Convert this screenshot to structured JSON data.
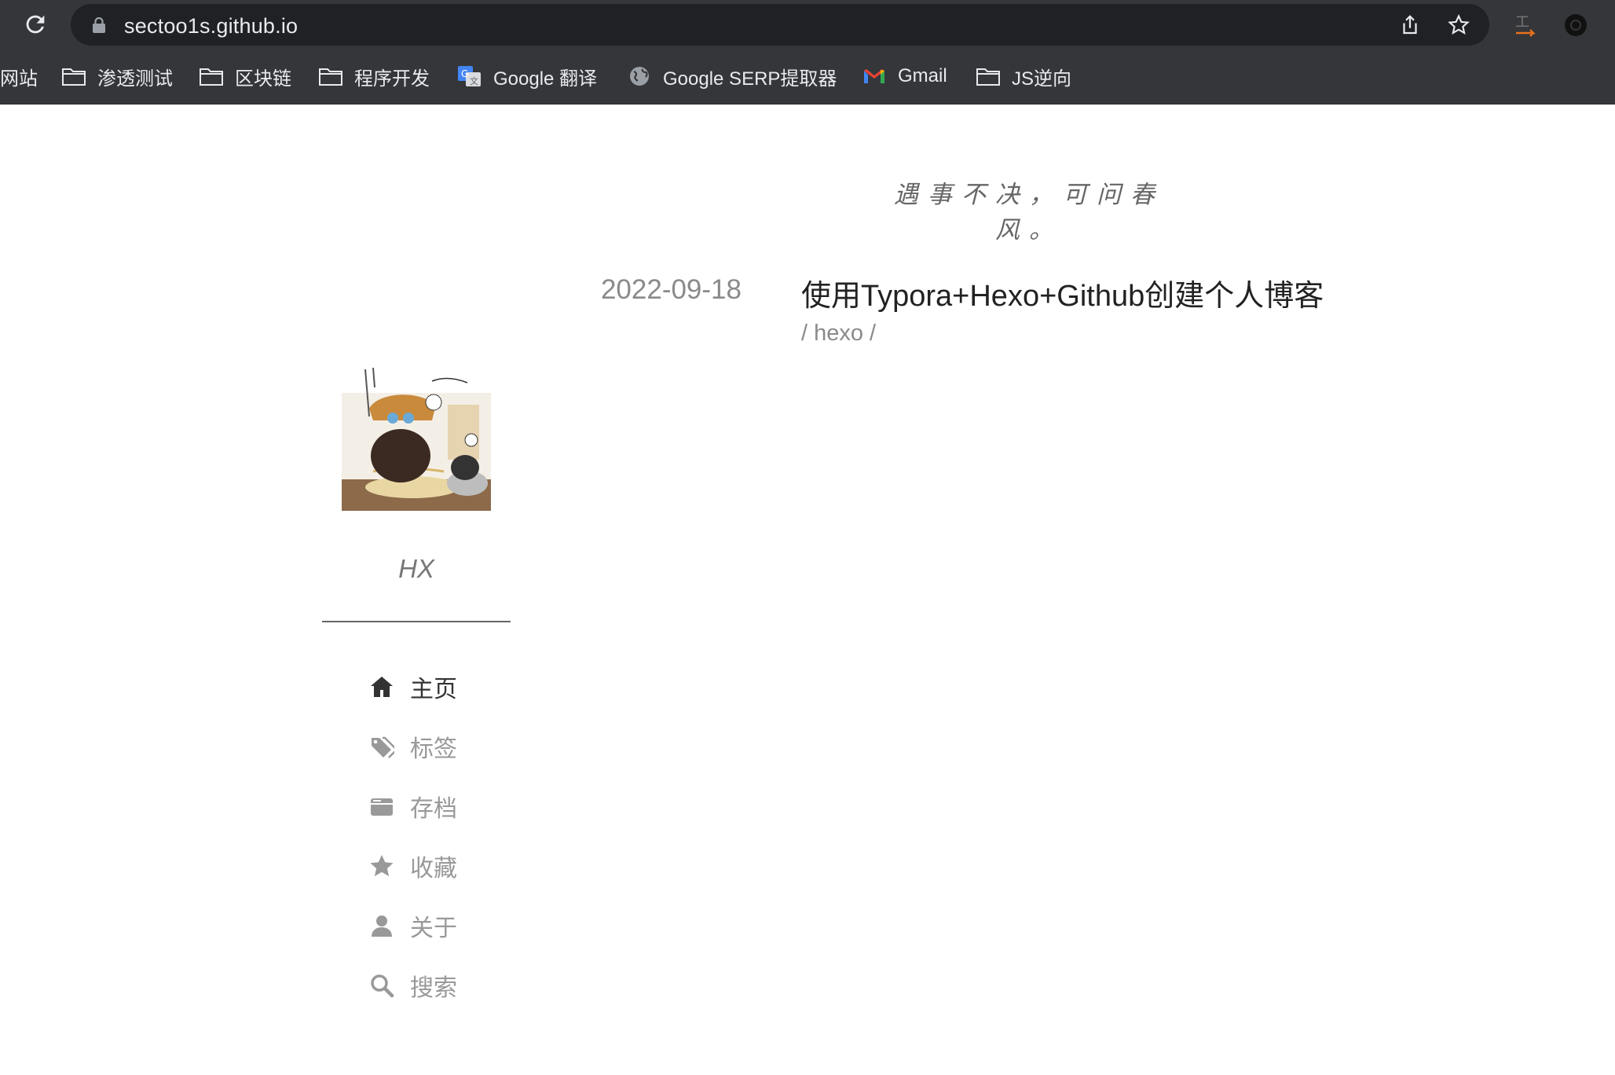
{
  "browser": {
    "url": "sectoo1s.github.io",
    "bookmarks": [
      {
        "label": "网站",
        "icon": "folder-icon"
      },
      {
        "label": "渗透测试",
        "icon": "folder-icon"
      },
      {
        "label": "区块链",
        "icon": "folder-icon"
      },
      {
        "label": "程序开发",
        "icon": "folder-icon"
      },
      {
        "label": "Google 翻译",
        "icon": "google-translate-icon"
      },
      {
        "label": "Google SERP提取器",
        "icon": "globe-icon"
      },
      {
        "label": "Gmail",
        "icon": "gmail-icon"
      },
      {
        "label": "JS逆向",
        "icon": "folder-icon"
      }
    ]
  },
  "blog": {
    "motto": "遇事不决，可问春风。",
    "author": "HX",
    "menu": [
      {
        "label": "主页",
        "icon": "home-icon",
        "active": true
      },
      {
        "label": "标签",
        "icon": "tags-icon",
        "active": false
      },
      {
        "label": "存档",
        "icon": "archive-icon",
        "active": false
      },
      {
        "label": "收藏",
        "icon": "star-icon",
        "active": false
      },
      {
        "label": "关于",
        "icon": "user-icon",
        "active": false
      },
      {
        "label": "搜索",
        "icon": "search-icon",
        "active": false
      }
    ],
    "posts": [
      {
        "date": "2022-09-18",
        "title": "使用Typora+Hexo+Github创建个人博客",
        "tags": "/ hexo /"
      }
    ]
  },
  "colors": {
    "chrome_bg": "#35363a",
    "omnibox_bg": "#202124",
    "text_active": "#333333",
    "text_muted": "#999999"
  }
}
